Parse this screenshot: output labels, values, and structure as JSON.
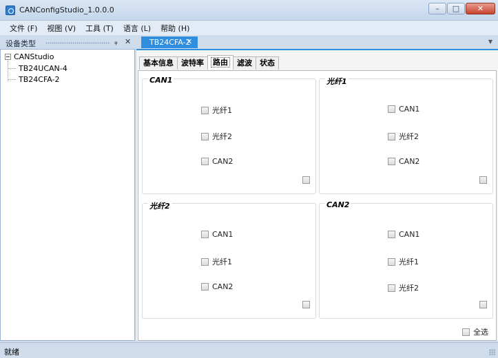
{
  "window": {
    "title": "CANConfigStudio_1.0.0.0",
    "controls": {
      "minimize": "–",
      "maximize": "□",
      "close": "✕"
    }
  },
  "menu": {
    "items": [
      {
        "label": "文件 (F)"
      },
      {
        "label": "视图 (V)"
      },
      {
        "label": "工具 (T)"
      },
      {
        "label": "语言 (L)"
      },
      {
        "label": "帮助 (H)"
      }
    ]
  },
  "device_panel": {
    "title": "设备类型",
    "pin": "ᵩ",
    "close": "✕",
    "tree": {
      "root": "CANStudio",
      "children": [
        "TB24UCAN-4",
        "TB24CFA-2"
      ]
    }
  },
  "document": {
    "tab_label": "TB24CFA-2",
    "tab_close": "✕",
    "dropdown_arrow": "▼",
    "page_tabs": [
      {
        "label": "基本信息"
      },
      {
        "label": "波特率"
      },
      {
        "label": "路由",
        "active": true
      },
      {
        "label": "滤波"
      },
      {
        "label": "状态"
      }
    ]
  },
  "routing": {
    "groups": [
      {
        "title": "CAN1",
        "options": [
          "光纤1",
          "光纤2",
          "CAN2"
        ]
      },
      {
        "title": "光纤1",
        "options": [
          "CAN1",
          "光纤2",
          "CAN2"
        ]
      },
      {
        "title": "光纤2",
        "options": [
          "CAN1",
          "光纤1",
          "CAN2"
        ]
      },
      {
        "title": "CAN2",
        "options": [
          "CAN1",
          "光纤1",
          "光纤2"
        ]
      }
    ],
    "select_all": "全选"
  },
  "status": {
    "text": "就绪"
  },
  "colors": {
    "accent": "#2f8ee0",
    "chrome": "#cfdcec",
    "close_button": "#c8452f"
  }
}
